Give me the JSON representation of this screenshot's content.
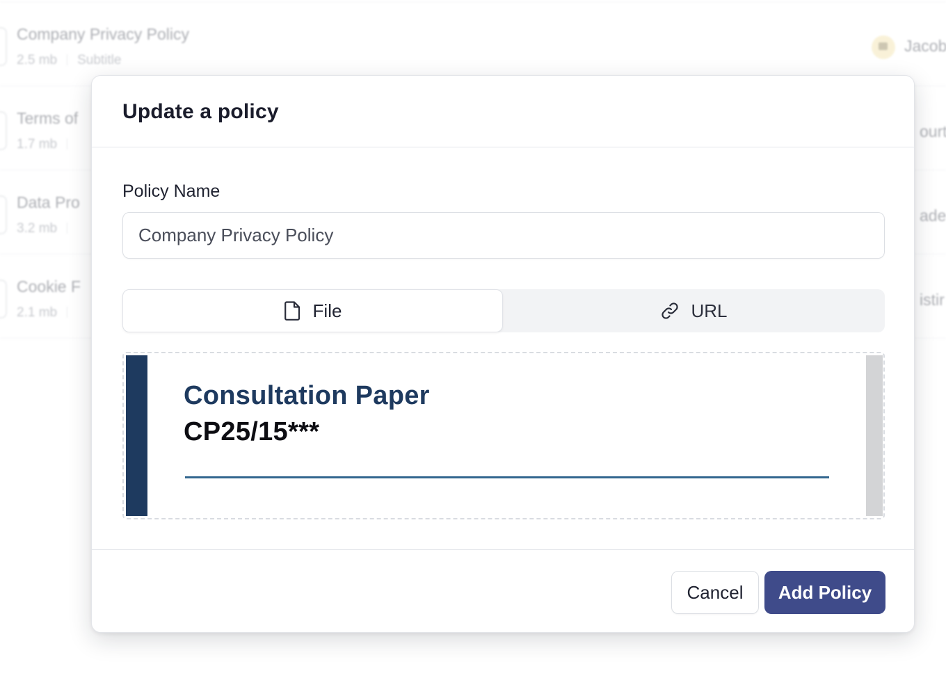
{
  "background_list": {
    "rows": [
      {
        "title": "Company Privacy Policy",
        "size": "2.5 mb",
        "subtitle": "Subtitle",
        "owner": "Jacob"
      },
      {
        "title": "Terms of",
        "size": "1.7 mb",
        "subtitle": "",
        "owner": "ourt"
      },
      {
        "title": "Data Pro",
        "size": "3.2 mb",
        "subtitle": "",
        "owner": "ade"
      },
      {
        "title": "Cookie F",
        "size": "2.1 mb",
        "subtitle": "",
        "owner": "istir"
      }
    ]
  },
  "modal": {
    "title": "Update a policy",
    "policy_name_label": "Policy Name",
    "policy_name_value": "Company Privacy Policy",
    "tabs": [
      {
        "label": "File",
        "icon": "file-icon",
        "active": true
      },
      {
        "label": "URL",
        "icon": "link-icon",
        "active": false
      }
    ],
    "preview": {
      "title": "Consultation Paper",
      "reference": "CP25/15***"
    },
    "cancel_label": "Cancel",
    "submit_label": "Add Policy"
  },
  "colors": {
    "primary": "#3f4b8a",
    "preview_navy": "#1e3a5f",
    "preview_rule": "#33678f"
  }
}
